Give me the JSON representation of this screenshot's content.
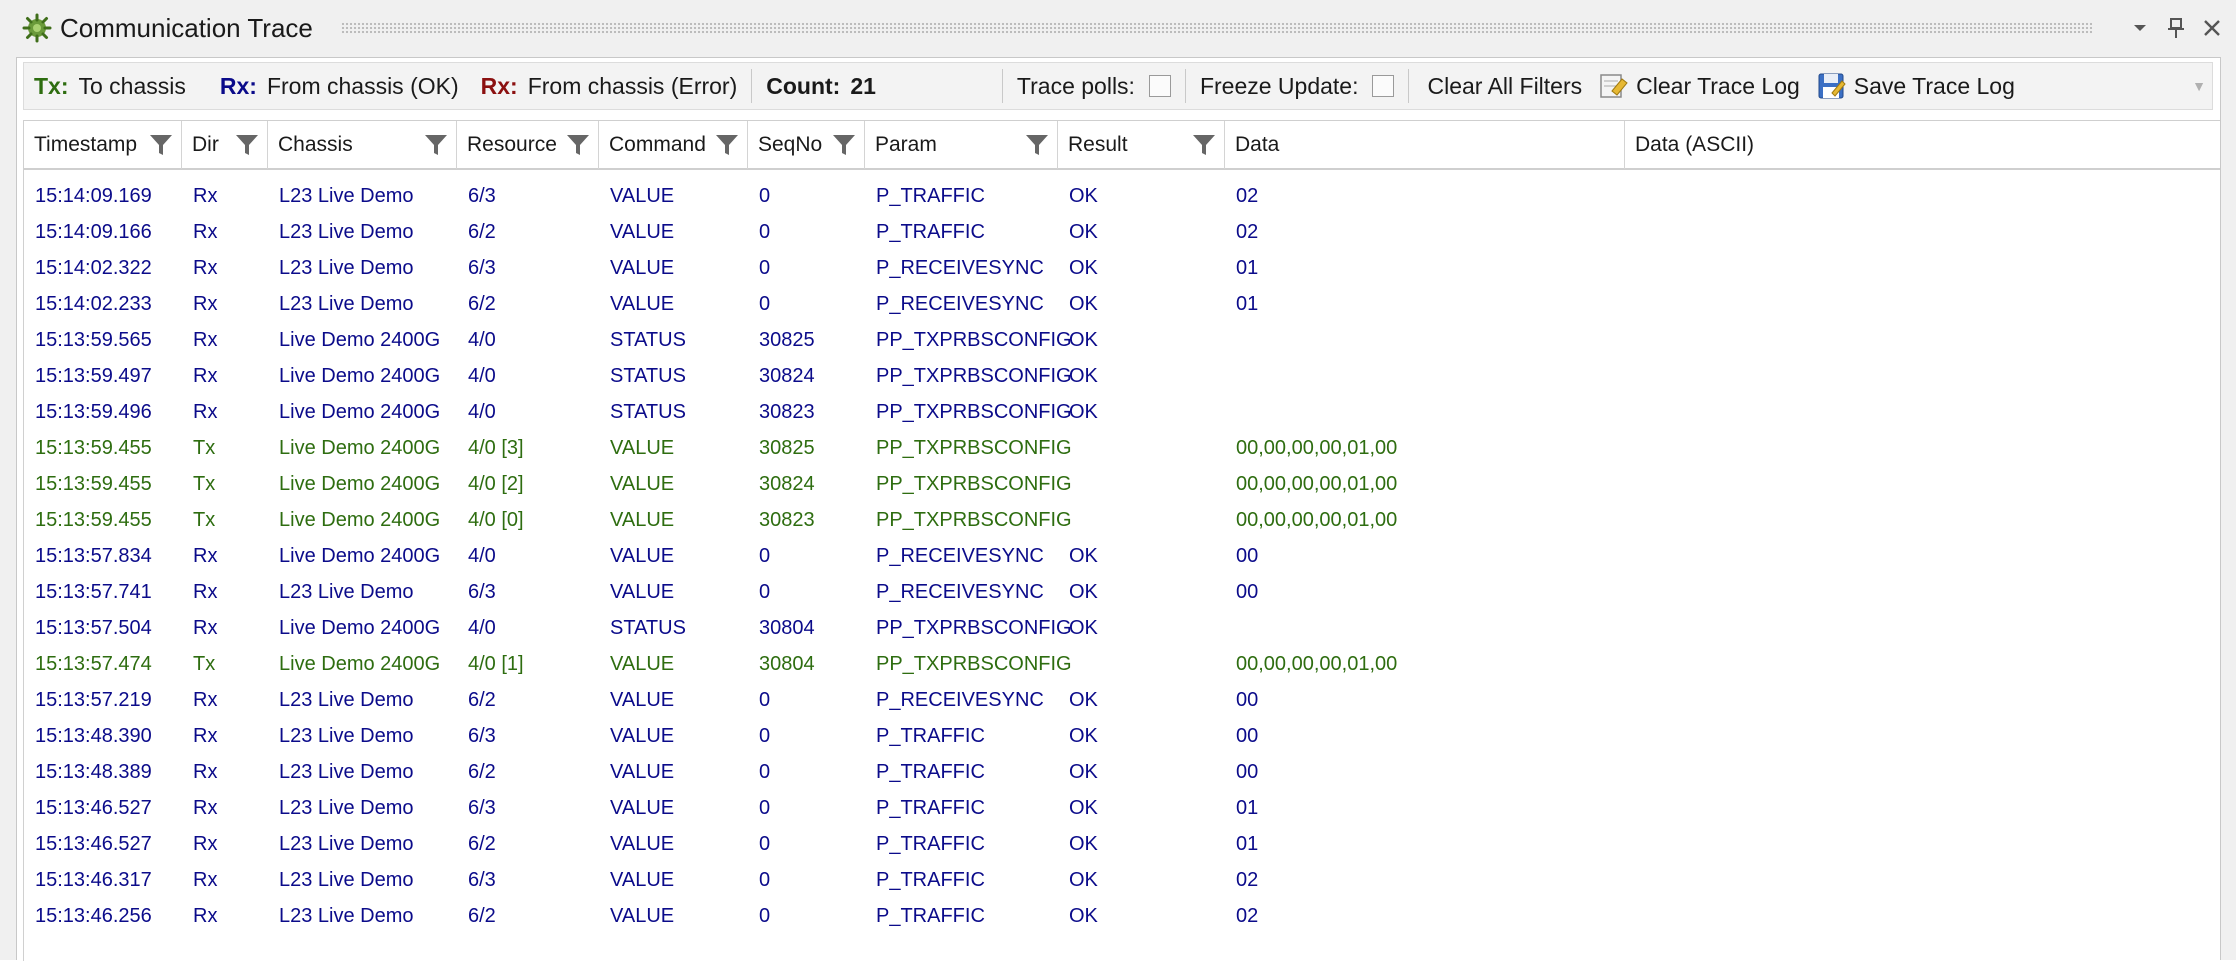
{
  "window": {
    "title": "Communication Trace",
    "icon": "gear-bug-icon",
    "buttons": [
      "chevron-down-icon",
      "pin-icon",
      "close-icon"
    ]
  },
  "toolbar": {
    "legend": [
      {
        "key": "Tx:",
        "text": "To chassis",
        "color": "#2e6d10"
      },
      {
        "key": "Rx:",
        "text": "From chassis (OK)",
        "color": "#0b0b8a"
      },
      {
        "key": "Rx:",
        "text": "From chassis (Error)",
        "color": "#8b1010"
      }
    ],
    "count_label": "Count:",
    "count_value": "21",
    "trace_polls_label": "Trace polls:",
    "freeze_update_label": "Freeze Update:",
    "clear_filters_label": "Clear All Filters",
    "clear_log_label": "Clear Trace Log",
    "save_log_label": "Save Trace Log"
  },
  "columns": [
    "Timestamp",
    "Dir",
    "Chassis",
    "Resource",
    "Command",
    "SeqNo",
    "Param",
    "Result",
    "Data",
    "Data (ASCII)"
  ],
  "rows": [
    {
      "dir": "Rx",
      "ts": "15:14:09.169",
      "chassis": "L23 Live Demo",
      "res": "6/3",
      "cmd": "VALUE",
      "seq": "0",
      "param": "P_TRAFFIC",
      "result": "OK",
      "data": "02"
    },
    {
      "dir": "Rx",
      "ts": "15:14:09.166",
      "chassis": "L23 Live Demo",
      "res": "6/2",
      "cmd": "VALUE",
      "seq": "0",
      "param": "P_TRAFFIC",
      "result": "OK",
      "data": "02"
    },
    {
      "dir": "Rx",
      "ts": "15:14:02.322",
      "chassis": "L23 Live Demo",
      "res": "6/3",
      "cmd": "VALUE",
      "seq": "0",
      "param": "P_RECEIVESYNC",
      "result": "OK",
      "data": "01"
    },
    {
      "dir": "Rx",
      "ts": "15:14:02.233",
      "chassis": "L23 Live Demo",
      "res": "6/2",
      "cmd": "VALUE",
      "seq": "0",
      "param": "P_RECEIVESYNC",
      "result": "OK",
      "data": "01"
    },
    {
      "dir": "Rx",
      "ts": "15:13:59.565",
      "chassis": "Live Demo 2400G",
      "res": "4/0",
      "cmd": "STATUS",
      "seq": "30825",
      "param": "PP_TXPRBSCONFIG",
      "result": "OK",
      "data": ""
    },
    {
      "dir": "Rx",
      "ts": "15:13:59.497",
      "chassis": "Live Demo 2400G",
      "res": "4/0",
      "cmd": "STATUS",
      "seq": "30824",
      "param": "PP_TXPRBSCONFIG",
      "result": "OK",
      "data": ""
    },
    {
      "dir": "Rx",
      "ts": "15:13:59.496",
      "chassis": "Live Demo 2400G",
      "res": "4/0",
      "cmd": "STATUS",
      "seq": "30823",
      "param": "PP_TXPRBSCONFIG",
      "result": "OK",
      "data": ""
    },
    {
      "dir": "Tx",
      "ts": "15:13:59.455",
      "chassis": "Live Demo 2400G",
      "res": "4/0 [3]",
      "cmd": "VALUE",
      "seq": "30825",
      "param": "PP_TXPRBSCONFIG",
      "result": "",
      "data": "00,00,00,00,01,00"
    },
    {
      "dir": "Tx",
      "ts": "15:13:59.455",
      "chassis": "Live Demo 2400G",
      "res": "4/0 [2]",
      "cmd": "VALUE",
      "seq": "30824",
      "param": "PP_TXPRBSCONFIG",
      "result": "",
      "data": "00,00,00,00,01,00"
    },
    {
      "dir": "Tx",
      "ts": "15:13:59.455",
      "chassis": "Live Demo 2400G",
      "res": "4/0 [0]",
      "cmd": "VALUE",
      "seq": "30823",
      "param": "PP_TXPRBSCONFIG",
      "result": "",
      "data": "00,00,00,00,01,00"
    },
    {
      "dir": "Rx",
      "ts": "15:13:57.834",
      "chassis": "Live Demo 2400G",
      "res": "4/0",
      "cmd": "VALUE",
      "seq": "0",
      "param": "P_RECEIVESYNC",
      "result": "OK",
      "data": "00"
    },
    {
      "dir": "Rx",
      "ts": "15:13:57.741",
      "chassis": "L23 Live Demo",
      "res": "6/3",
      "cmd": "VALUE",
      "seq": "0",
      "param": "P_RECEIVESYNC",
      "result": "OK",
      "data": "00"
    },
    {
      "dir": "Rx",
      "ts": "15:13:57.504",
      "chassis": "Live Demo 2400G",
      "res": "4/0",
      "cmd": "STATUS",
      "seq": "30804",
      "param": "PP_TXPRBSCONFIG",
      "result": "OK",
      "data": ""
    },
    {
      "dir": "Tx",
      "ts": "15:13:57.474",
      "chassis": "Live Demo 2400G",
      "res": "4/0 [1]",
      "cmd": "VALUE",
      "seq": "30804",
      "param": "PP_TXPRBSCONFIG",
      "result": "",
      "data": "00,00,00,00,01,00"
    },
    {
      "dir": "Rx",
      "ts": "15:13:57.219",
      "chassis": "L23 Live Demo",
      "res": "6/2",
      "cmd": "VALUE",
      "seq": "0",
      "param": "P_RECEIVESYNC",
      "result": "OK",
      "data": "00"
    },
    {
      "dir": "Rx",
      "ts": "15:13:48.390",
      "chassis": "L23 Live Demo",
      "res": "6/3",
      "cmd": "VALUE",
      "seq": "0",
      "param": "P_TRAFFIC",
      "result": "OK",
      "data": "00"
    },
    {
      "dir": "Rx",
      "ts": "15:13:48.389",
      "chassis": "L23 Live Demo",
      "res": "6/2",
      "cmd": "VALUE",
      "seq": "0",
      "param": "P_TRAFFIC",
      "result": "OK",
      "data": "00"
    },
    {
      "dir": "Rx",
      "ts": "15:13:46.527",
      "chassis": "L23 Live Demo",
      "res": "6/3",
      "cmd": "VALUE",
      "seq": "0",
      "param": "P_TRAFFIC",
      "result": "OK",
      "data": "01"
    },
    {
      "dir": "Rx",
      "ts": "15:13:46.527",
      "chassis": "L23 Live Demo",
      "res": "6/2",
      "cmd": "VALUE",
      "seq": "0",
      "param": "P_TRAFFIC",
      "result": "OK",
      "data": "01"
    },
    {
      "dir": "Rx",
      "ts": "15:13:46.317",
      "chassis": "L23 Live Demo",
      "res": "6/3",
      "cmd": "VALUE",
      "seq": "0",
      "param": "P_TRAFFIC",
      "result": "OK",
      "data": "02"
    },
    {
      "dir": "Rx",
      "ts": "15:13:46.256",
      "chassis": "L23 Live Demo",
      "res": "6/2",
      "cmd": "VALUE",
      "seq": "0",
      "param": "P_TRAFFIC",
      "result": "OK",
      "data": "02"
    }
  ]
}
